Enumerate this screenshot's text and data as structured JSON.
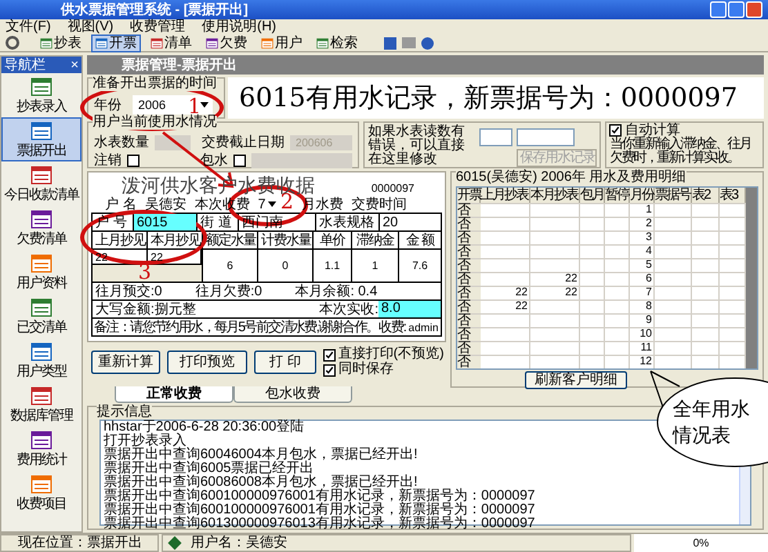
{
  "window": {
    "title": "供水票据管理系统 - [票据开出]"
  },
  "menu": [
    "文件(F)",
    "视图(V)",
    "收费管理",
    "使用说明(H)"
  ],
  "toolbar": [
    {
      "label": "抄表",
      "selected": false
    },
    {
      "label": "开票",
      "selected": true
    },
    {
      "label": "清单",
      "selected": false
    },
    {
      "label": "欠费",
      "selected": false
    },
    {
      "label": "用户",
      "selected": false
    },
    {
      "label": "检索",
      "selected": false
    }
  ],
  "sidebar": {
    "title": "导航栏",
    "close": "×",
    "items": [
      {
        "label": "抄表录入",
        "selected": false
      },
      {
        "label": "票据开出",
        "selected": true
      },
      {
        "label": "今日收款清单",
        "selected": false
      },
      {
        "label": "欠费清单",
        "selected": false
      },
      {
        "label": "用户资料",
        "selected": false
      },
      {
        "label": "已交清单",
        "selected": false
      },
      {
        "label": "用户类型",
        "selected": false
      },
      {
        "label": "数据库管理",
        "selected": false
      },
      {
        "label": "费用统计",
        "selected": false
      },
      {
        "label": "收费项目",
        "selected": false
      }
    ]
  },
  "page_header": "票据管理-票据开出",
  "ticket_time": {
    "legend": "准备开出票据的时间",
    "year_label": "年份",
    "year_value": "2006"
  },
  "message": "6015有用水记录，新票据号为：0000097",
  "usage": {
    "legend": "用户当前使用水情况",
    "meter_count_label": "水表数量",
    "deadline_label": "交费截止日期",
    "deadline_value": "200606",
    "cancel_label": "注销",
    "cancel_checked": false,
    "package_label": "包水",
    "package_checked": false
  },
  "correction": {
    "hint": "如果水表读数有错误，可以直接在这里修改",
    "save_button": "保存用水记录"
  },
  "auto_calc": {
    "label": "自动计算",
    "checked": true,
    "hint": "当你重新输入滞纳金、往月欠费时，重新计算实收。"
  },
  "receipt": {
    "title": "泼河供水客户水费收据",
    "number": "0000097",
    "name_label": "户  名",
    "name_value": "吴德安",
    "charge_label": "本次收费",
    "charge_value": "7",
    "month_label": "月水费",
    "time_label": "交费时间",
    "account_label": "户  号",
    "account_value": "6015",
    "street_label": "街  道",
    "street_value": "西门南",
    "meter_spec_label": "水表规格",
    "meter_spec_value": "20",
    "columns": [
      "上月抄见",
      "本月抄见",
      "额定水量",
      "计费水量",
      "单价",
      "滞纳金",
      "金  额"
    ],
    "values": [
      "22",
      "22",
      "6",
      "0",
      "1.1",
      "1",
      "7.6"
    ],
    "prepaid": "往月预交:0",
    "arrears": "往月欠费:0",
    "balance": "本月余额: 0.4",
    "amount_words": "大写金额:捌元整",
    "paid_label": "本次实收:",
    "paid_value": "8.0",
    "note": "备注：请您节约用水，每月5号前交清水费,谢谢合作。",
    "cashier_label": "收费:",
    "cashier_value": "admin"
  },
  "actions": {
    "recalc": "重新计算",
    "preview": "打印预览",
    "print": "打 印",
    "options": [
      {
        "label": "直接打印(不预览)",
        "checked": true
      },
      {
        "label": "同时保存",
        "checked": true
      }
    ]
  },
  "tabs": [
    {
      "label": "正常收费",
      "selected": true
    },
    {
      "label": "包水收费",
      "selected": false
    }
  ],
  "detail": {
    "legend": "6015(吴德安) 2006年  用水及费用明细",
    "columns": [
      "开票",
      "上月抄表",
      "本月抄表",
      "包月",
      "暂停",
      "月份",
      "票据号",
      "表2",
      "表3"
    ],
    "rows": [
      [
        "否",
        "",
        "",
        "",
        "",
        "1",
        "",
        "",
        ""
      ],
      [
        "否",
        "",
        "",
        "",
        "",
        "2",
        "",
        "",
        ""
      ],
      [
        "否",
        "",
        "",
        "",
        "",
        "3",
        "",
        "",
        ""
      ],
      [
        "否",
        "",
        "",
        "",
        "",
        "4",
        "",
        "",
        ""
      ],
      [
        "否",
        "",
        "",
        "",
        "",
        "5",
        "",
        "",
        ""
      ],
      [
        "否",
        "",
        "22",
        "",
        "",
        "6",
        "",
        "",
        ""
      ],
      [
        "否",
        "22",
        "22",
        "",
        "",
        "7",
        "",
        "",
        ""
      ],
      [
        "否",
        "22",
        "",
        "",
        "",
        "8",
        "",
        "",
        ""
      ],
      [
        "否",
        "",
        "",
        "",
        "",
        "9",
        "",
        "",
        ""
      ],
      [
        "否",
        "",
        "",
        "",
        "",
        "10",
        "",
        "",
        ""
      ],
      [
        "否",
        "",
        "",
        "",
        "",
        "11",
        "",
        "",
        ""
      ],
      [
        "否",
        "",
        "",
        "",
        "",
        "12",
        "",
        "",
        ""
      ]
    ],
    "refresh_button": "刷新客户明细"
  },
  "log": {
    "legend": "提示信息",
    "lines": [
      "hhstar于2006-6-28 20:36:00登陆",
      "打开抄表录入",
      "票据开出中查询60046004本月包水，票据已经开出!",
      "票据开出中查询6005票据已经开出",
      "票据开出中查询60086008本月包水，票据已经开出!",
      "票据开出中查询600100000976001有用水记录，新票据号为：0000097",
      "票据开出中查询600100000976001有用水记录，新票据号为：0000097",
      "票据开出中查询601300000976013有用水记录，新票据号为：0000097"
    ]
  },
  "status_bar": {
    "location": "现在位置：票据开出",
    "user": "用户名：吴德安",
    "progress": {
      "text": "0%",
      "level": 0
    }
  },
  "annotations": [
    {
      "kind": "circle",
      "label": "1"
    },
    {
      "kind": "circle",
      "label": "2"
    },
    {
      "kind": "circle",
      "label": "3"
    },
    {
      "kind": "callout",
      "label": "全年用水情况表"
    }
  ]
}
